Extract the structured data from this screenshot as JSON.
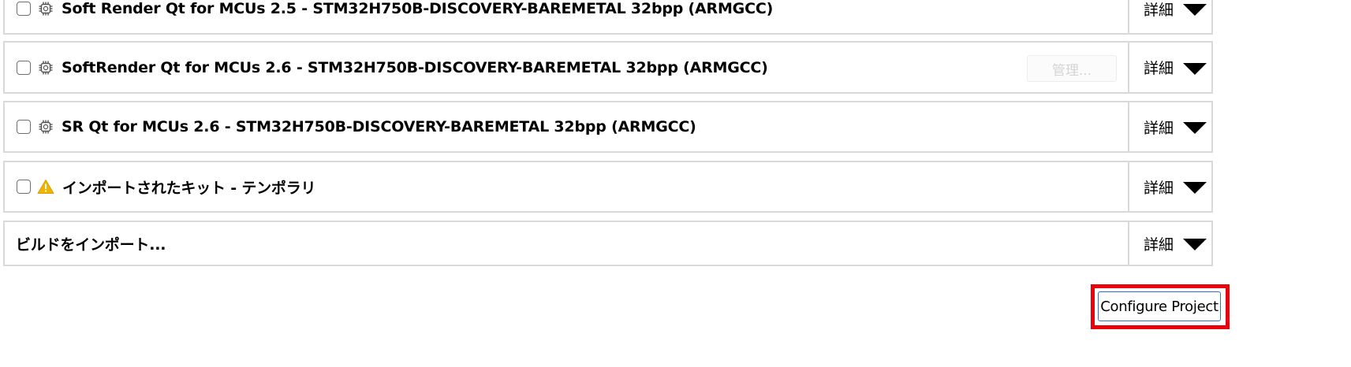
{
  "kits": [
    {
      "label": "Soft Render Qt for MCUs 2.5 - STM32H750B-DISCOVERY-BAREMETAL 32bpp (ARMGCC)",
      "icon": "qt-mcu-chip-icon",
      "checked": false,
      "details_label": "詳細"
    },
    {
      "label": "SoftRender Qt for MCUs 2.6 - STM32H750B-DISCOVERY-BAREMETAL 32bpp (ARMGCC)",
      "icon": "qt-mcu-chip-icon",
      "checked": false,
      "manage_label": "管理...",
      "details_label": "詳細"
    },
    {
      "label": "SR Qt for MCUs 2.6 - STM32H750B-DISCOVERY-BAREMETAL 32bpp (ARMGCC)",
      "icon": "qt-mcu-chip-icon",
      "checked": false,
      "details_label": "詳細"
    },
    {
      "label": "インポートされたキット - テンポラリ",
      "icon": "warning-icon",
      "checked": false,
      "details_label": "詳細"
    }
  ],
  "import_build": {
    "label": "ビルドをインポート...",
    "details_label": "詳細"
  },
  "configure_button": {
    "label": "Configure Project"
  },
  "colors": {
    "highlight": "#e8000b",
    "button_border": "#2f6fd6",
    "warning": "#f0b400",
    "row_border": "#d9d9d9"
  }
}
